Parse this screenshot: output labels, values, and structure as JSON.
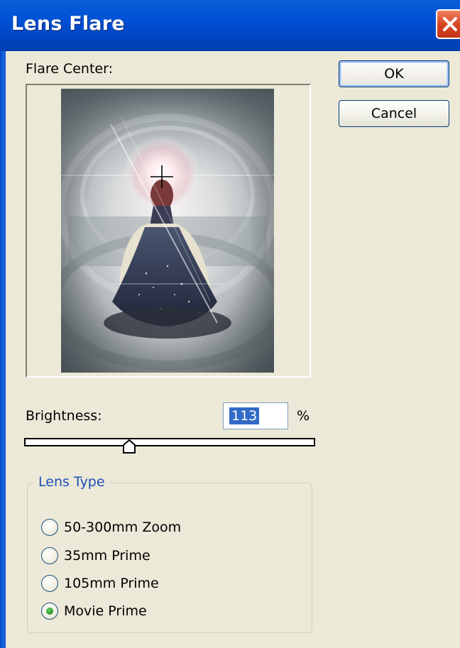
{
  "window": {
    "title": "Lens Flare"
  },
  "flare_center": {
    "label": "Flare Center:"
  },
  "buttons": {
    "ok": "OK",
    "cancel": "Cancel"
  },
  "brightness": {
    "label": "Brightness:",
    "value": "113",
    "unit": "%"
  },
  "lens_type": {
    "legend": "Lens Type",
    "options": [
      {
        "label": "50-300mm Zoom",
        "selected": false
      },
      {
        "label": "35mm Prime",
        "selected": false
      },
      {
        "label": "105mm Prime",
        "selected": false
      },
      {
        "label": "Movie Prime",
        "selected": true
      }
    ]
  },
  "colors": {
    "title_bar": "#0052d6",
    "dialog_bg": "#ece9d8",
    "close_button": "#d9421e",
    "selection": "#316ac5",
    "group_legend": "#1f4fb5",
    "radio_dot": "#2e9a2e"
  },
  "icons": {
    "close": "close-x-icon",
    "crosshair": "crosshair-icon",
    "slider_thumb": "slider-thumb-icon"
  }
}
